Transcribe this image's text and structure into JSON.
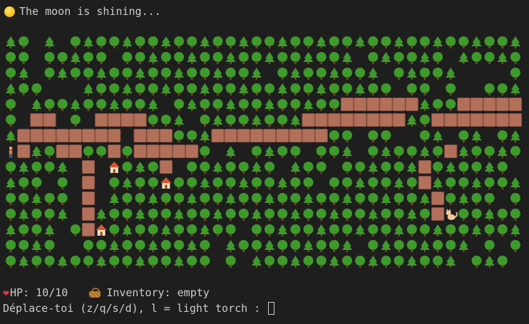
{
  "status": {
    "icon": "moon-icon",
    "message": "The moon is shining..."
  },
  "map": {
    "cols": 40,
    "rows": 15,
    "legend": {
      "T": "tree",
      "#": "path",
      "@": "player",
      "H": "house",
      "C": "cat",
      ".": "ground"
    },
    "grid": [
      "TT.T.TTTTTTTTTTTTTTTTTTTTTTTTTTTTTTTTTTT",
      "TT.TTTTT.TTTTTTTTTTTTTTTTTT.TTTTTT.TTTTT",
      "TT.TTTTTTTTTTTTTTTTT.TTTTTTTT.TTTTT....T",
      "TTT...TTTTTTTTTTTTTTTTTTTTTTTT.TT.T..TTT",
      "T.TTTTTTTTTT.TTTTTTTTTTTTT######TTT#####",
      "T.##.T.####TTT.TTTTTTTT########TT########",
      "T########.###TTT#########TT.TT..TT.TT.TT",
      "@#TT##TT#T#####T.T.TTTT.TTT.TTTTTT#TTTTT",
      "TTTTT.#.HTTT#.TTTTTTT.TTT.TTTTTT#TTTTTT.",
      "TTT.T.#.TTTTHTTTTTTTTTTT.TTTTTTT#TTTTTTT",
      "TTTTT.#.TTTTTTTTTTTTTTTTTTTTTTTTT#TTTT.T",
      "TTTTT.#TTTTTTTTTTTTTTTTTTTTTTTTTT#CTTTTT",
      "TTTT.T#HTTTTTTTTTT.TTTTTTTTTTTTTTTTTTTTT",
      "TTTT..TTTTTTTTTT.TTTTTTTTTT.TTTTTTTT.T.T",
      "TTTTTTTTTTTTTTTT.T.TTTTTTTTTTTTTTTT.TTT."
    ]
  },
  "hud": {
    "heart_icon": "heart-icon",
    "hp_label": "HP: 10/10",
    "basket_icon": "basket-icon",
    "inventory_label": "Inventory: empty"
  },
  "prompt": {
    "text": "Déplace-toi (z/q/s/d), l = light torch : ",
    "input_value": ""
  },
  "colors": {
    "background": "#1e1e1e",
    "text": "#cccccc",
    "tree": "#3f9a2c",
    "trunk": "#7a4a22",
    "path": "#b2705a",
    "path_border": "#8c5342"
  }
}
